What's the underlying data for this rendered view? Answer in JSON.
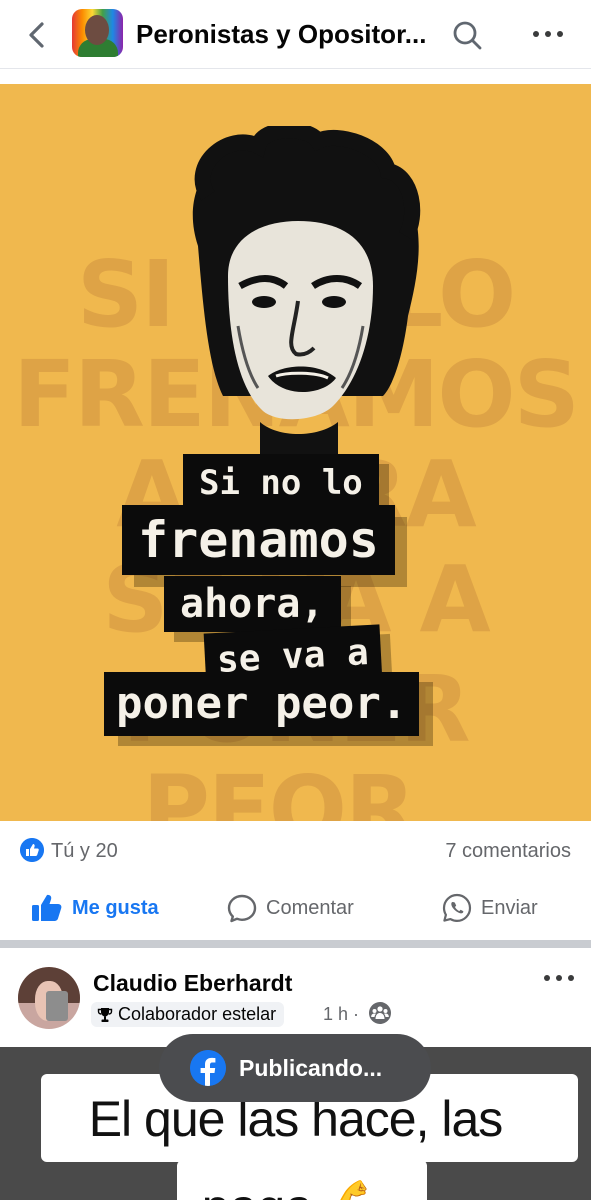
{
  "header": {
    "group_name": "Peronistas y Opositores",
    "back_icon": "chevron-left-icon",
    "search_icon": "search-icon",
    "more_icon": "more-dots-icon"
  },
  "post1": {
    "poster": {
      "label_1": "Si no lo",
      "label_2": "frenamos",
      "label_3": "ahora,",
      "label_4": "se va a",
      "label_5": "poner peor."
    },
    "reactions": "Tú y 20",
    "comments": "7 comentarios",
    "actions": {
      "like": "Me gusta",
      "comment": "Comentar",
      "share": "Enviar"
    }
  },
  "post2": {
    "author": "Claudio Eberhardt",
    "badge": "Colaborador estelar",
    "time": "1 h ·",
    "caption_line1": "El que las hace, las",
    "caption_line2": "paga 💪"
  },
  "toast": {
    "text": "Publicando..."
  },
  "colors": {
    "brand": "#1877f2",
    "poster_bg": "#f0b84e",
    "secondary_text": "#65676b"
  }
}
